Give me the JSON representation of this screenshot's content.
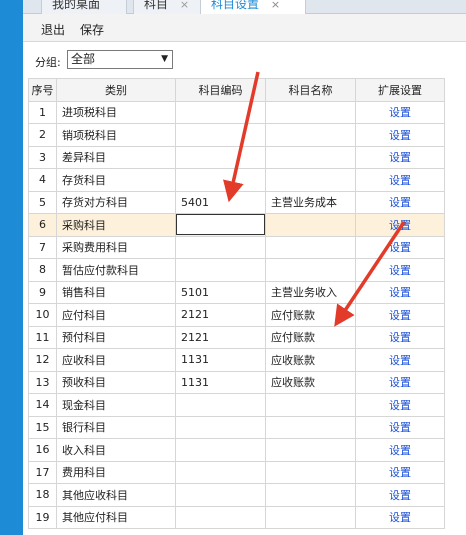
{
  "tabs": [
    {
      "label": "我的桌面",
      "close": ""
    },
    {
      "label": "科目",
      "close": "×"
    },
    {
      "label": "科目设置",
      "close": "×"
    }
  ],
  "toolbar": {
    "exit_label": "退出",
    "save_label": "保存"
  },
  "filter": {
    "label": "分组:",
    "selected": "全部",
    "caret": "▼"
  },
  "table": {
    "headers": [
      "序号",
      "类别",
      "科目编码",
      "科目名称",
      "扩展设置"
    ],
    "rows": [
      {
        "seq": "1",
        "category": "进项税科目",
        "code": "",
        "name": "",
        "action": "设置"
      },
      {
        "seq": "2",
        "category": "销项税科目",
        "code": "",
        "name": "",
        "action": "设置"
      },
      {
        "seq": "3",
        "category": "差异科目",
        "code": "",
        "name": "",
        "action": "设置"
      },
      {
        "seq": "4",
        "category": "存货科目",
        "code": "",
        "name": "",
        "action": "设置"
      },
      {
        "seq": "5",
        "category": "存货对方科目",
        "code": "5401",
        "name": "主营业务成本",
        "action": "设置"
      },
      {
        "seq": "6",
        "category": "采购科目",
        "code": "",
        "name": "",
        "action": "设置"
      },
      {
        "seq": "7",
        "category": "采购费用科目",
        "code": "",
        "name": "",
        "action": "设置"
      },
      {
        "seq": "8",
        "category": "暂估应付款科目",
        "code": "",
        "name": "",
        "action": "设置"
      },
      {
        "seq": "9",
        "category": "销售科目",
        "code": "5101",
        "name": "主营业务收入",
        "action": "设置"
      },
      {
        "seq": "10",
        "category": "应付科目",
        "code": "2121",
        "name": "应付账款",
        "action": "设置"
      },
      {
        "seq": "11",
        "category": "预付科目",
        "code": "2121",
        "name": "应付账款",
        "action": "设置"
      },
      {
        "seq": "12",
        "category": "应收科目",
        "code": "1131",
        "name": "应收账款",
        "action": "设置"
      },
      {
        "seq": "13",
        "category": "预收科目",
        "code": "1131",
        "name": "应收账款",
        "action": "设置"
      },
      {
        "seq": "14",
        "category": "现金科目",
        "code": "",
        "name": "",
        "action": "设置"
      },
      {
        "seq": "15",
        "category": "银行科目",
        "code": "",
        "name": "",
        "action": "设置"
      },
      {
        "seq": "16",
        "category": "收入科目",
        "code": "",
        "name": "",
        "action": "设置"
      },
      {
        "seq": "17",
        "category": "费用科目",
        "code": "",
        "name": "",
        "action": "设置"
      },
      {
        "seq": "18",
        "category": "其他应收科目",
        "code": "",
        "name": "",
        "action": "设置"
      },
      {
        "seq": "19",
        "category": "其他应付科目",
        "code": "",
        "name": "",
        "action": "设置"
      }
    ]
  },
  "colors": {
    "accent": "#1e8bd6",
    "link": "#1a4fd6",
    "highlight_row": "#fdf1dc",
    "arrow": "#e23b2a"
  }
}
